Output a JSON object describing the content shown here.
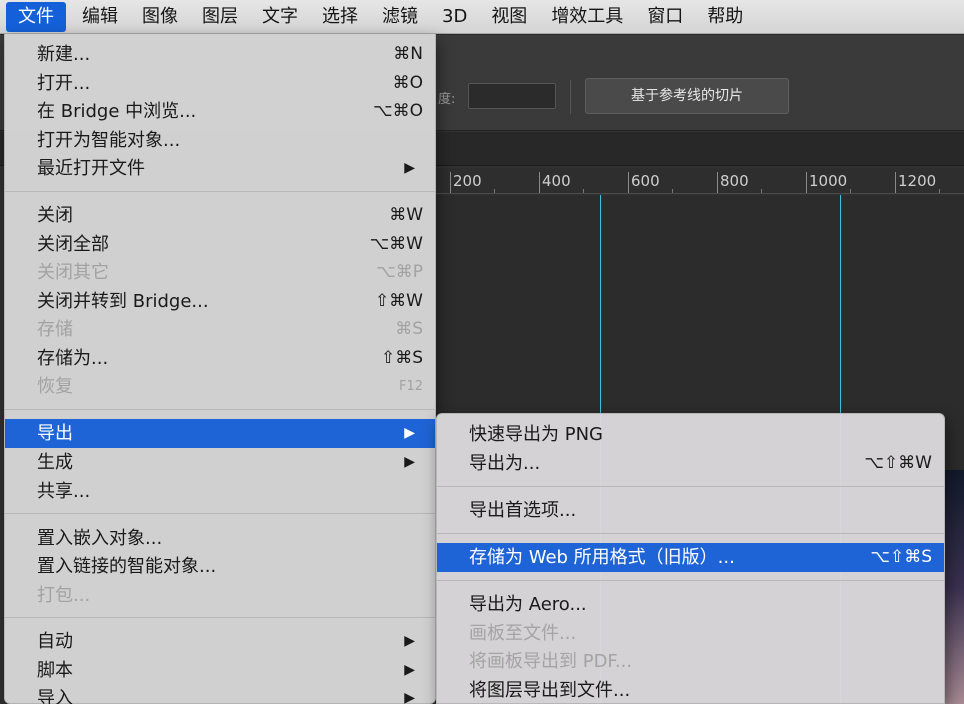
{
  "menubar": {
    "items": [
      "文件",
      "编辑",
      "图像",
      "图层",
      "文字",
      "选择",
      "滤镜",
      "3D",
      "视图",
      "增效工具",
      "窗口",
      "帮助"
    ],
    "active_index": 0
  },
  "options_bar": {
    "label_fragment": "度:",
    "button_label": "基于参考线的切片"
  },
  "ruler": {
    "labels": [
      "200",
      "400",
      "600",
      "800",
      "1000",
      "1200"
    ]
  },
  "file_menu": {
    "items": [
      {
        "label": "新建...",
        "shortcut": "⌘N"
      },
      {
        "label": "打开...",
        "shortcut": "⌘O"
      },
      {
        "label": "在 Bridge 中浏览...",
        "shortcut": "⌥⌘O"
      },
      {
        "label": "打开为智能对象..."
      },
      {
        "label": "最近打开文件",
        "submenu": true
      },
      {
        "label": "关闭",
        "shortcut": "⌘W"
      },
      {
        "label": "关闭全部",
        "shortcut": "⌥⌘W"
      },
      {
        "label": "关闭其它",
        "shortcut": "⌥⌘P",
        "disabled": true
      },
      {
        "label": "关闭并转到 Bridge...",
        "shortcut": "⇧⌘W"
      },
      {
        "label": "存储",
        "shortcut": "⌘S",
        "disabled": true
      },
      {
        "label": "存储为...",
        "shortcut": "⇧⌘S"
      },
      {
        "label": "恢复",
        "shortcut": "F12",
        "disabled": true
      },
      {
        "label": "导出",
        "submenu": true,
        "selected": true
      },
      {
        "label": "生成",
        "submenu": true
      },
      {
        "label": "共享..."
      },
      {
        "label": "置入嵌入对象..."
      },
      {
        "label": "置入链接的智能对象..."
      },
      {
        "label": "打包...",
        "disabled": true
      },
      {
        "label": "自动",
        "submenu": true
      },
      {
        "label": "脚本",
        "submenu": true
      },
      {
        "label": "导入",
        "submenu": true
      }
    ]
  },
  "export_submenu": {
    "items": [
      {
        "label": "快速导出为 PNG"
      },
      {
        "label": "导出为...",
        "shortcut": "⌥⇧⌘W"
      },
      {
        "label": "导出首选项..."
      },
      {
        "label": "存储为 Web 所用格式（旧版）...",
        "shortcut": "⌥⇧⌘S",
        "selected": true
      },
      {
        "label": "导出为 Aero..."
      },
      {
        "label": "画板至文件...",
        "disabled": true
      },
      {
        "label": "将画板导出到 PDF...",
        "disabled": true
      },
      {
        "label": "将图层导出到文件..."
      }
    ]
  },
  "icons": {
    "submenu_arrow": "triangle-right-icon",
    "arrow_glyph": "▶"
  },
  "colors": {
    "selection": "#1f64d6",
    "guide": "#37c6e6"
  }
}
